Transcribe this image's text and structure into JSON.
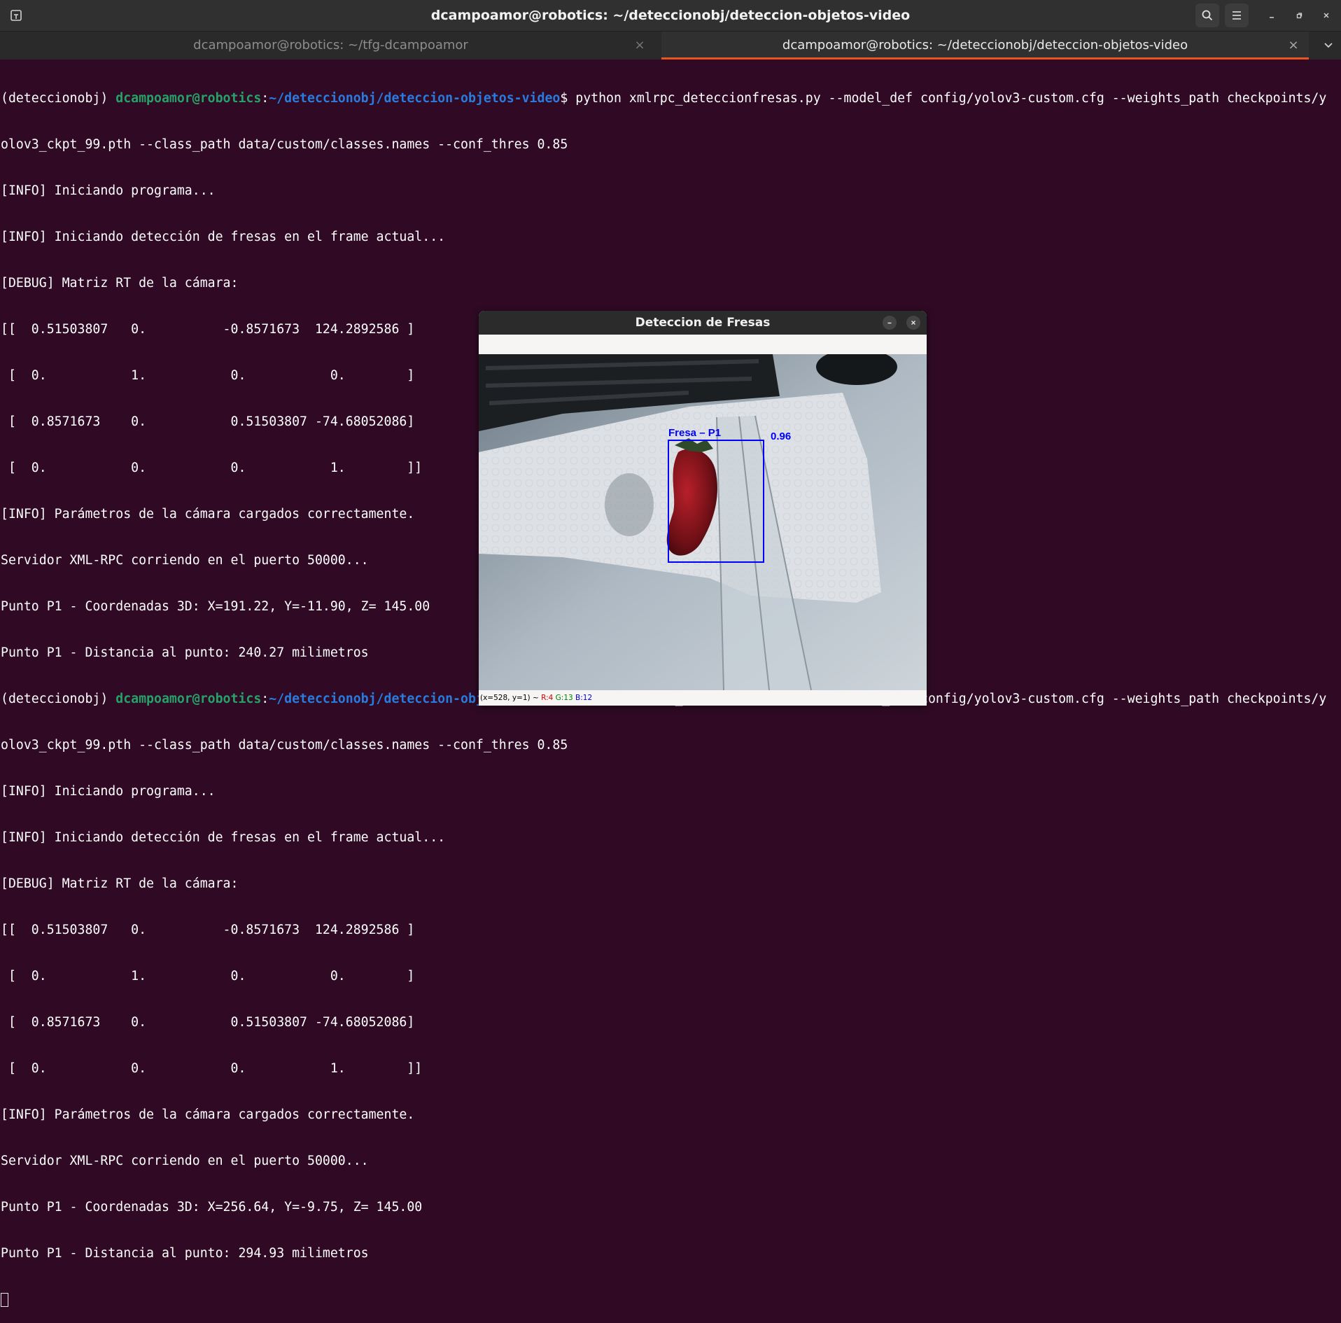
{
  "header": {
    "title": "dcampoamor@robotics: ~/deteccionobj/deteccion-objetos-video",
    "icons": [
      "new-tab-icon",
      "search-icon",
      "hamburger-menu-icon",
      "minimize-icon",
      "maximize-icon",
      "close-icon"
    ]
  },
  "tabs": [
    {
      "label": "dcampoamor@robotics: ~/tfg-dcampoamor",
      "active": false
    },
    {
      "label": "dcampoamor@robotics: ~/deteccionobj/deteccion-objetos-video",
      "active": true
    }
  ],
  "colors": {
    "terminal_bg": "#300a24",
    "prompt_user": "#26a269",
    "prompt_path": "#2a7bde",
    "accent": "#e95420",
    "bbox": "#0000ff"
  },
  "terminal": {
    "prompt_env": "(deteccionobj) ",
    "prompt_user": "dcampoamor@robotics",
    "prompt_sep": ":",
    "prompt_path": "~/deteccionobj/deteccion-objetos-video",
    "prompt_end": "$ ",
    "command_part1": "python xmlrpc_deteccionfresas.py --model_def config/yolov3-custom.cfg --weights_path checkpoints/y",
    "command_part2": "olov3_ckpt_99.pth --class_path data/custom/classes.names --conf_thres 0.85",
    "run1": [
      "[INFO] Iniciando programa...",
      "[INFO] Iniciando detección de fresas en el frame actual...",
      "[DEBUG] Matriz RT de la cámara:",
      "[[  0.51503807   0.          -0.8571673  124.2892586 ]",
      " [  0.           1.           0.           0.        ]",
      " [  0.8571673    0.           0.51503807 -74.68052086]",
      " [  0.           0.           0.           1.        ]]",
      "[INFO] Parámetros de la cámara cargados correctamente.",
      "Servidor XML-RPC corriendo en el puerto 50000...",
      "Punto P1 - Coordenadas 3D: X=191.22, Y=-11.90, Z= 145.00",
      "Punto P1 - Distancia al punto: 240.27 milimetros"
    ],
    "run2": [
      "[INFO] Iniciando programa...",
      "[INFO] Iniciando detección de fresas en el frame actual...",
      "[DEBUG] Matriz RT de la cámara:",
      "[[  0.51503807   0.          -0.8571673  124.2892586 ]",
      " [  0.           1.           0.           0.        ]",
      " [  0.8571673    0.           0.51503807 -74.68052086]",
      " [  0.           0.           0.           1.        ]]",
      "[INFO] Parámetros de la cámara cargados correctamente.",
      "Servidor XML-RPC corriendo en el puerto 50000...",
      "Punto P1 - Coordenadas 3D: X=256.64, Y=-9.75, Z= 145.00",
      "Punto P1 - Distancia al punto: 294.93 milimetros"
    ]
  },
  "cv_window": {
    "title": "Deteccion de Fresas",
    "detection_label": "Fresa – P1",
    "confidence": "0.96",
    "status_prefix": "(x=528, y=1) ~ ",
    "status_r": "R:4",
    "status_g": "G:13",
    "status_b": "B:12"
  }
}
